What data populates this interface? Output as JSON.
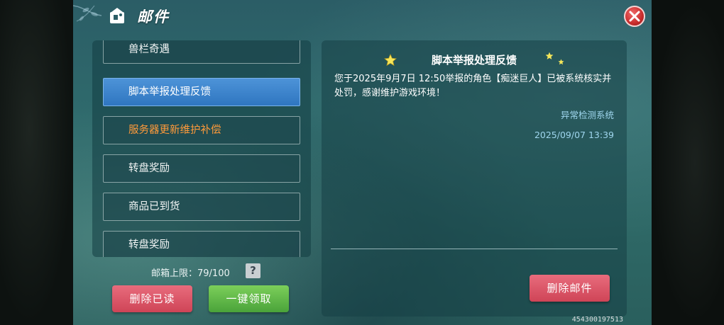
{
  "window": {
    "title": "邮件"
  },
  "mail_list": [
    {
      "label": "兽栏奇遇",
      "state": "normal"
    },
    {
      "label": "脚本举报处理反馈",
      "state": "selected"
    },
    {
      "label": "服务器更新维护补偿",
      "state": "unread"
    },
    {
      "label": "转盘奖励",
      "state": "normal"
    },
    {
      "label": "商品已到货",
      "state": "normal"
    },
    {
      "label": "转盘奖励",
      "state": "normal"
    }
  ],
  "mailbox": {
    "limit_text": "邮箱上限：79/100",
    "help_label": "?"
  },
  "buttons": {
    "delete_read": "删除已读",
    "collect_all": "一键领取",
    "delete_mail": "删除邮件"
  },
  "detail": {
    "title": "脚本举报处理反馈",
    "body": "您于2025年9月7日 12:50举报的角色【痴迷巨人】已被系统核实并处罚，感谢维护游戏环境！",
    "sender": "异常检测系统",
    "date": "2025/09/07 13:39"
  },
  "footer": {
    "uid": "454300197513"
  },
  "colors": {
    "selected_item": "#3f86cf",
    "unread_text": "#ff9a3a",
    "red_button": "#d94c5f",
    "green_button": "#5cb545",
    "meta_text": "#9fd6ee"
  },
  "icons": [
    "mail-icon",
    "close-icon",
    "help-icon",
    "star-icon"
  ]
}
